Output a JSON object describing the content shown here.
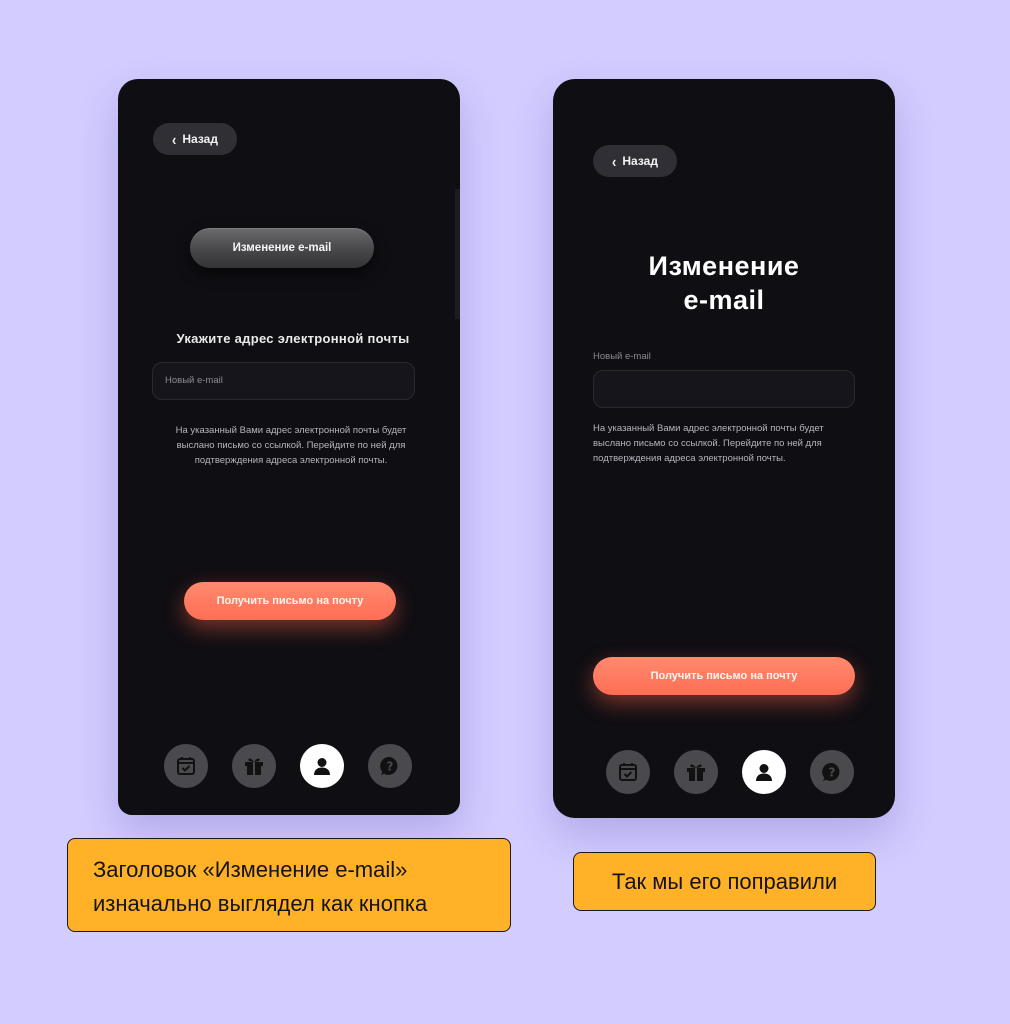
{
  "colors": {
    "background": "#d2ccff",
    "phone": "#0f0e13",
    "accent": "#ff7a5f",
    "caption": "#ffb128",
    "nav_inactive": "#4a4a4e",
    "nav_active": "#ffffff"
  },
  "before": {
    "back_label": "Назад",
    "title_button": "Изменение e-mail",
    "prompt": "Укажите адрес электронной почты",
    "input_placeholder": "Новый e-mail",
    "help_text": "На указанный Вами адрес электронной почты будет выслано письмо со ссылкой. Перейдите по ней для подтверждения адреса электронной почты.",
    "cta": "Получить письмо на почту",
    "caption_line1": "Заголовок «Изменение e-mail»",
    "caption_line2": "изначально выглядел как кнопка"
  },
  "after": {
    "back_label": "Назад",
    "title_line1": "Изменение",
    "title_line2": "e-mail",
    "field_label": "Новый e-mail",
    "input_value": "",
    "help_text": "На указанный Вами адрес электронной почты будет выслано письмо со ссылкой. Перейдите по ней для подтверждения адреса электронной почты.",
    "cta": "Получить письмо на почту",
    "caption": "Так мы его поправили"
  },
  "nav_items": [
    {
      "icon": "calendar-check-icon",
      "active": false
    },
    {
      "icon": "gift-icon",
      "active": false
    },
    {
      "icon": "user-icon",
      "active": true
    },
    {
      "icon": "help-chat-icon",
      "active": false
    }
  ]
}
